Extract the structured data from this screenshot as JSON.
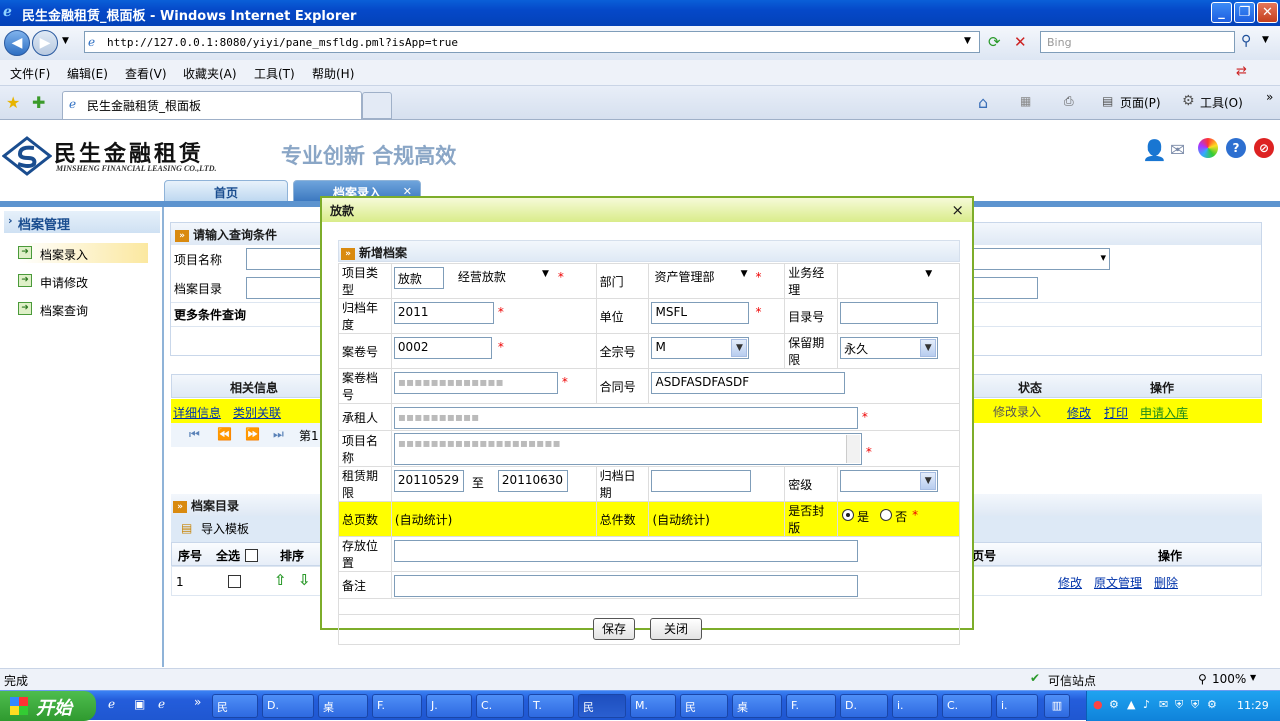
{
  "window": {
    "title": "民生金融租赁_根面板 - Windows Internet Explorer",
    "min": "_",
    "max": "❐",
    "close": "✕"
  },
  "browser": {
    "url": "http://127.0.0.1:8080/yiyi/pane_msfldg.pml?isApp=true",
    "search_placeholder": "Bing",
    "menus": [
      "文件(F)",
      "编辑(E)",
      "查看(V)",
      "收藏夹(A)",
      "工具(T)",
      "帮助(H)"
    ],
    "tab_title": "民生金融租赁_根面板",
    "cmd_page": "页面(P)",
    "cmd_tools": "工具(O)"
  },
  "site": {
    "logo_cn": "民生金融租赁",
    "logo_en": "MINSHENG FINANCIAL LEASING CO.,LTD.",
    "slogan": "专业创新  合规高效",
    "nav_tabs": [
      "首页",
      "档案录入"
    ]
  },
  "sidebar": {
    "heading": "档案管理",
    "items": [
      "档案录入",
      "申请修改",
      "档案查询"
    ]
  },
  "query": {
    "title": "请输入查询条件",
    "label_project": "项目名称",
    "label_catalog": "档案目录",
    "more": "更多条件查询"
  },
  "results": {
    "col_related": "相关信息",
    "col_status": "状态",
    "col_ops": "操作",
    "row_links": [
      "详细信息",
      "类别关联"
    ],
    "row_status": "修改录入",
    "row_ops": [
      "修改",
      "打印",
      "申请入库"
    ],
    "pager": "第1"
  },
  "catalog": {
    "title": "档案目录",
    "import": "导入模板",
    "cols": [
      "序号",
      "全选",
      "排序",
      "页号",
      "操作"
    ],
    "row_no": "1",
    "row_ops": [
      "修改",
      "原文管理",
      "删除"
    ]
  },
  "dialog": {
    "title": "放款",
    "close": "×",
    "section": "新增档案",
    "labels": {
      "project_type": "项目类型",
      "department": "部门",
      "manager": "业务经理",
      "archive_year": "归档年度",
      "unit": "单位",
      "catalog_no": "目录号",
      "volume_no": "案卷号",
      "fonds_no": "全宗号",
      "retention": "保留期限",
      "volume_file_no": "案卷档号",
      "contract_no": "合同号",
      "lessee": "承租人",
      "project_name": "项目名称",
      "lease_term": "租赁期限",
      "to": "至",
      "archive_date": "归档日期",
      "secrecy": "密级",
      "total_pages": "总页数",
      "total_items": "总件数",
      "sealed": "是否封版",
      "location": "存放位置",
      "remarks": "备注"
    },
    "values": {
      "project_type": "放款",
      "project_subtype": "经营放款",
      "department": "资产管理部",
      "archive_year": "2011",
      "unit": "MSFL",
      "volume_no": "0002",
      "fonds_no": "M",
      "retention": "永久",
      "contract_no": "ASDFASDFASDF",
      "lease_from": "20110529",
      "lease_to": "20110630",
      "auto": "(自动统计)",
      "yes": "是",
      "no": "否"
    },
    "save": "保存",
    "cancel": "关闭"
  },
  "status": {
    "left": "完成",
    "zone": "可信站点",
    "zoom": "100%"
  },
  "taskbar": {
    "start": "开始",
    "buttons": [
      "民",
      "D.",
      "桌",
      "F.",
      "J.",
      "C.",
      "T.",
      "民",
      "M.",
      "民",
      "桌",
      "F.",
      "D.",
      "i.",
      "C.",
      "i."
    ],
    "clock": "11:29"
  }
}
